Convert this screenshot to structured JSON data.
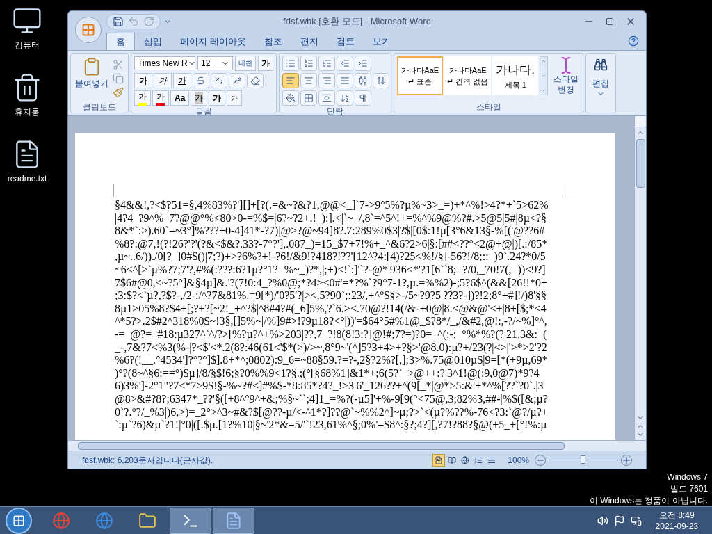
{
  "desktop": {
    "icons": [
      {
        "kind": "computer",
        "label": "컴퓨터"
      },
      {
        "kind": "recycle",
        "label": "휴지통"
      },
      {
        "kind": "file",
        "label": "readme.txt"
      }
    ],
    "notice": [
      "Windows 7",
      "빌드 7601",
      "이 Windows는 정품이 아닙니다."
    ]
  },
  "window": {
    "title": "fdsf.wbk [호환 모드] - Microsoft Word",
    "tabs": [
      {
        "label": "홈",
        "selected": true
      },
      {
        "label": "삽입",
        "selected": false
      },
      {
        "label": "페이지 레이아웃",
        "selected": false
      },
      {
        "label": "참조",
        "selected": false
      },
      {
        "label": "편지",
        "selected": false
      },
      {
        "label": "검토",
        "selected": false
      },
      {
        "label": "보기",
        "selected": false
      }
    ],
    "clipboard": {
      "paste": "붙여넣기",
      "label": "클립보드"
    },
    "font": {
      "name": "Times New R",
      "size": "12",
      "label": "글꼴",
      "phonetic": "내천",
      "clear": "가",
      "row2": [
        {
          "kind": "bold",
          "text": "가"
        },
        {
          "kind": "italic",
          "text": "가"
        },
        {
          "kind": "underline",
          "text": "가"
        }
      ],
      "row3": [
        {
          "kind": "highlight",
          "text": "가"
        },
        {
          "kind": "color",
          "text": "가"
        },
        {
          "kind": "case",
          "text": "Aa"
        },
        {
          "kind": "shade",
          "text": "가"
        },
        {
          "kind": "grow",
          "text": "가"
        },
        {
          "kind": "shrink",
          "text": "가"
        }
      ]
    },
    "paragraph": {
      "label": "단락",
      "alignments": [
        {
          "kind": "left",
          "selected": true
        },
        {
          "kind": "center",
          "selected": false
        },
        {
          "kind": "right",
          "selected": false
        },
        {
          "kind": "justify",
          "selected": false
        },
        {
          "kind": "distribute",
          "selected": false
        }
      ]
    },
    "styles": {
      "label": "스타일",
      "items": [
        {
          "preview": "가나다AaE",
          "name": "↵ 표준",
          "selected": true
        },
        {
          "preview": "가나다AaE",
          "name": "↵ 간격 없음",
          "selected": false
        },
        {
          "preview": "가나다.",
          "name": "제목 1",
          "selected": false
        }
      ],
      "change": "스타일 변경"
    },
    "editing": {
      "label": "편집"
    },
    "document": {
      "lines": [
        "§4&&!,?<$?51=§,4%83%?'][]+[?(.=&~?&?1,@@<_]`7->9°5%?µ%~3>_=)+*^%!>4?*+`5>62%",
        "|4?4_?9^%_7?@@°%<80>0-=%$=|6?~?2+.!_):].<|`~_/,8`=^5^!+=%^%9@%?#.>5@5|5#|8µ<?§",
        "8&*`:>).60`=~3°]%???+0-4]41*-?7)|@>?@~94]8?.7:289%0$3|?$|[0$:1!µ[3°6&13§-%[('@??6#",
        "%8?:@7,!(?!26?'?'(?&<$&?.33?-7°?'],.087_)=15_$7+7!%+_^&6?2>6|§:[##<??°<2@+@|)[.:/85*",
        ",µ~..6/))./0[?_]0#$()|7;?)+>?6%?+!-?6!/&9!?418?!??'[12^?4:[4)?25<%!/§]-56?!/8;::_)9`.24?*0/5",
        "~6<^[>`µ%?7;7'?,#%(:???:6?1µ?°1?=%~_)?*,|;+)<!`:]'`?-@*'936<*'?1[6``8;=?/0,_70!7(,=))<9?]",
        "7$6#@0,<~?5°]&§4µ]&.'?(7!0:4_?%0@;*?4><0#'=*?%`?9°7-1?,µ.=%%2)-;5?6$^(&&[26!!*0+",
        ";3:$?<`µ?,?$?-,/2-:/^?7&81%.=9[*)/'0?5'?|><,5?90`;:23/,+^°$§>-/5~?9?5|??3?-])?!2;8°+#]!/)8'§§",
        "8µ1>05%8?$4+[;?+?[~2!_+^?$|^8#4?#(_6]5%,?`6.><.70@?!14(/&-+0@|8.<@&@'<+|8+[$;*<4",
        "^*5?>.2$#2^318%0$~!3§,[]5%~|/%]9#>!?9µ18?<°|))'=$64°5#%1@_$?8*/_,/&#2,@!:,-?/~%]°^,",
        "-=_@?=_#18:µ327^`^/?>[%?µ?^+%>203|??,7_?!8(8!3:?]@!#;7?=)?0=_^(;-;_°%*%?(?|21,3&:_(",
        "_-,7&?7<%3(%-|?<$'<*.2(8?:46(61<'$*(>)/>~,8°9~'(^]5?3+4>+?§>'@8.0):µ?+/23(?|<>|'>*>2'?2",
        "%6?(!__.°4534']?°?°]$].8+*^;0802):9_6=~88§59.?=?-,2§?2%?[,];3>%.75@010µ$|9=[*(+9µ,69*",
        ")°?(8~^§6:==°)$µ]/8/§$!6;§?0%%9<1?§.;(°[§68%1]&1*+;6(5?`_>@++:?|3^1!@(:9,0@7)*9?4",
        "6)3%']-2°1\"?7<*7>9$!§-%~?#<]#%$-*8:85*?4?_!>3|6'_126??+^(9[_*|@*>5:&'+*^%[??`?0`.|3",
        "@8>&#?8?;6347*_??'§([+8^°9^+&;%§~``;4]1_=%?(-µ5]'+%-9[9(°<75@,3;82%3,##-|%$([&;µ?",
        "0`?.°?/_%3|)6,>)=_2°>^3~#&?$[@??-µ/<-^1*?]??@`~%%2^]~µ;?>`<(µ?%??%-76<?3:`@?/µ?+",
        "`:µ`?6)&µ`?1!|°0|([.$µ.[1?%10|§~'2*&=5/'`!23,61%^§;0%'=$8^:§?;4?][,?7!?88?§@(+5_+[°!%:µ"
      ]
    },
    "status": {
      "text": "fdsf.wbk: 6,203문자입니다(근사값).",
      "views": [
        {
          "kind": "print",
          "selected": true
        },
        {
          "kind": "read",
          "selected": false
        },
        {
          "kind": "web",
          "selected": false
        },
        {
          "kind": "outline",
          "selected": false
        },
        {
          "kind": "draft",
          "selected": false
        }
      ],
      "zoom": "100%",
      "level": 0.5
    }
  },
  "taskbar": {
    "apps": [
      {
        "kind": "chrome",
        "running": false
      },
      {
        "kind": "ie",
        "running": false
      },
      {
        "kind": "explorer",
        "running": false
      },
      {
        "kind": "cmd",
        "running": true
      },
      {
        "kind": "word",
        "running": true
      }
    ],
    "time": "오전 8:49",
    "date": "2021-09-23"
  }
}
